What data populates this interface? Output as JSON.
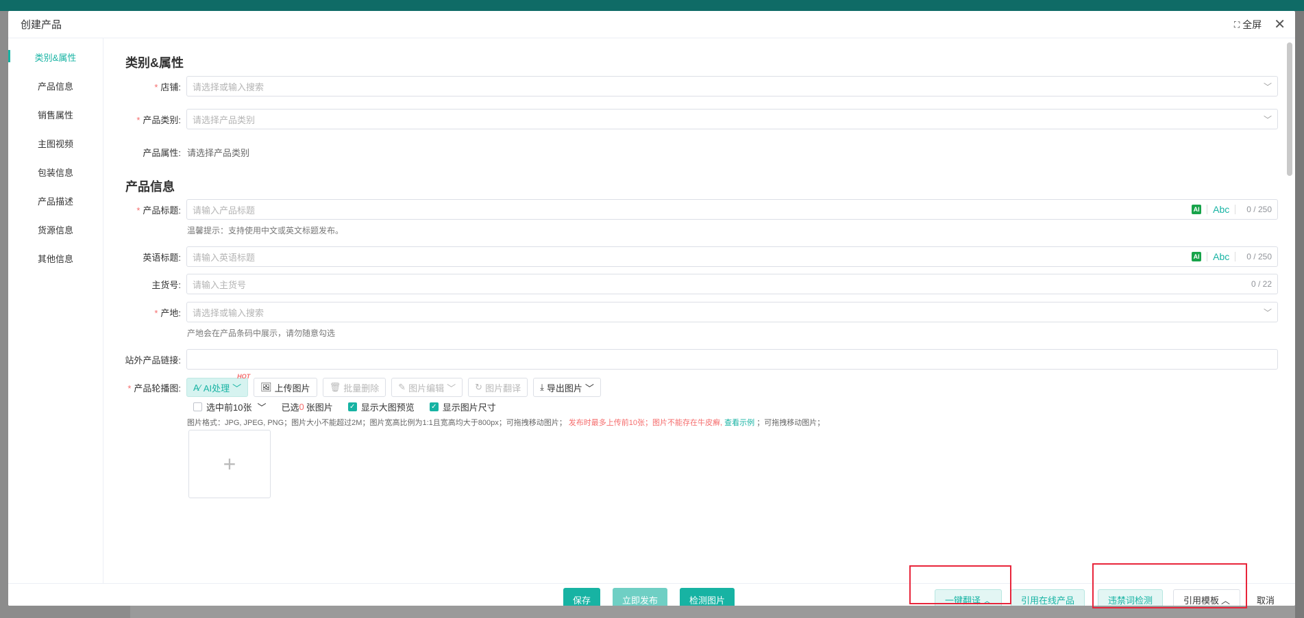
{
  "modal": {
    "title": "创建产品",
    "fullscreen_label": "全屏"
  },
  "sidebar": {
    "items": [
      {
        "label": "类别&属性",
        "active": true
      },
      {
        "label": "产品信息"
      },
      {
        "label": "销售属性"
      },
      {
        "label": "主图视频"
      },
      {
        "label": "包装信息"
      },
      {
        "label": "产品描述"
      },
      {
        "label": "货源信息"
      },
      {
        "label": "其他信息"
      }
    ]
  },
  "category_section": {
    "title": "类别&属性",
    "store": {
      "label": "店铺:",
      "placeholder": "请选择或输入搜索"
    },
    "category": {
      "label": "产品类别:",
      "placeholder": "请选择产品类别"
    },
    "attributes": {
      "label": "产品属性:",
      "value": "请选择产品类别"
    }
  },
  "product_section": {
    "title": "产品信息",
    "title_field": {
      "label": "产品标题:",
      "placeholder": "请输入产品标题",
      "ai": "AI",
      "abc": "Abc",
      "counter": "0 / 250",
      "hint": "温馨提示：支持使用中文或英文标题发布。"
    },
    "english_title": {
      "label": "英语标题:",
      "placeholder": "请输入英语标题",
      "ai": "AI",
      "abc": "Abc",
      "counter": "0 / 250"
    },
    "sku": {
      "label": "主货号:",
      "placeholder": "请输入主货号",
      "counter": "0 / 22"
    },
    "origin": {
      "label": "产地:",
      "placeholder": "请选择或输入搜索",
      "hint": "产地会在产品条码中展示，请勿随意勾选"
    },
    "external_link": {
      "label": "站外产品链接:",
      "placeholder": ""
    },
    "carousel": {
      "label": "产品轮播图:",
      "tools": {
        "ai": "AI处理",
        "hot": "HOT",
        "upload": "上传图片",
        "batch_delete": "批量删除",
        "edit": "图片编辑",
        "translate": "图片翻译",
        "export": "导出图片"
      },
      "select_top": "选中前10张",
      "selected_prefix": "已选",
      "selected_count": "0",
      "selected_suffix": "张图片",
      "show_preview": "显示大图预览",
      "show_size": "显示图片尺寸",
      "note_normal": "图片格式：JPG, JPEG, PNG；图片大小不能超过2M；图片宽高比例为1:1且宽高均大于800px；可拖拽移动图片；",
      "note_red": "发布时最多上传前10张；图片不能存在牛皮癣,",
      "note_link": "查看示例",
      "note_end": "；可拖拽移动图片；"
    }
  },
  "footer": {
    "save": "保存",
    "publish": "立即发布",
    "check_images": "检测图片",
    "translate_all": "一键翻译",
    "cite_online": "引用在线产品",
    "forbidden_check": "违禁词检测",
    "cite_template": "引用模板",
    "cancel": "取消"
  },
  "colors": {
    "accent": "#17b3a3",
    "required": "#f56c6c",
    "highlight_box": "#e8243a"
  }
}
